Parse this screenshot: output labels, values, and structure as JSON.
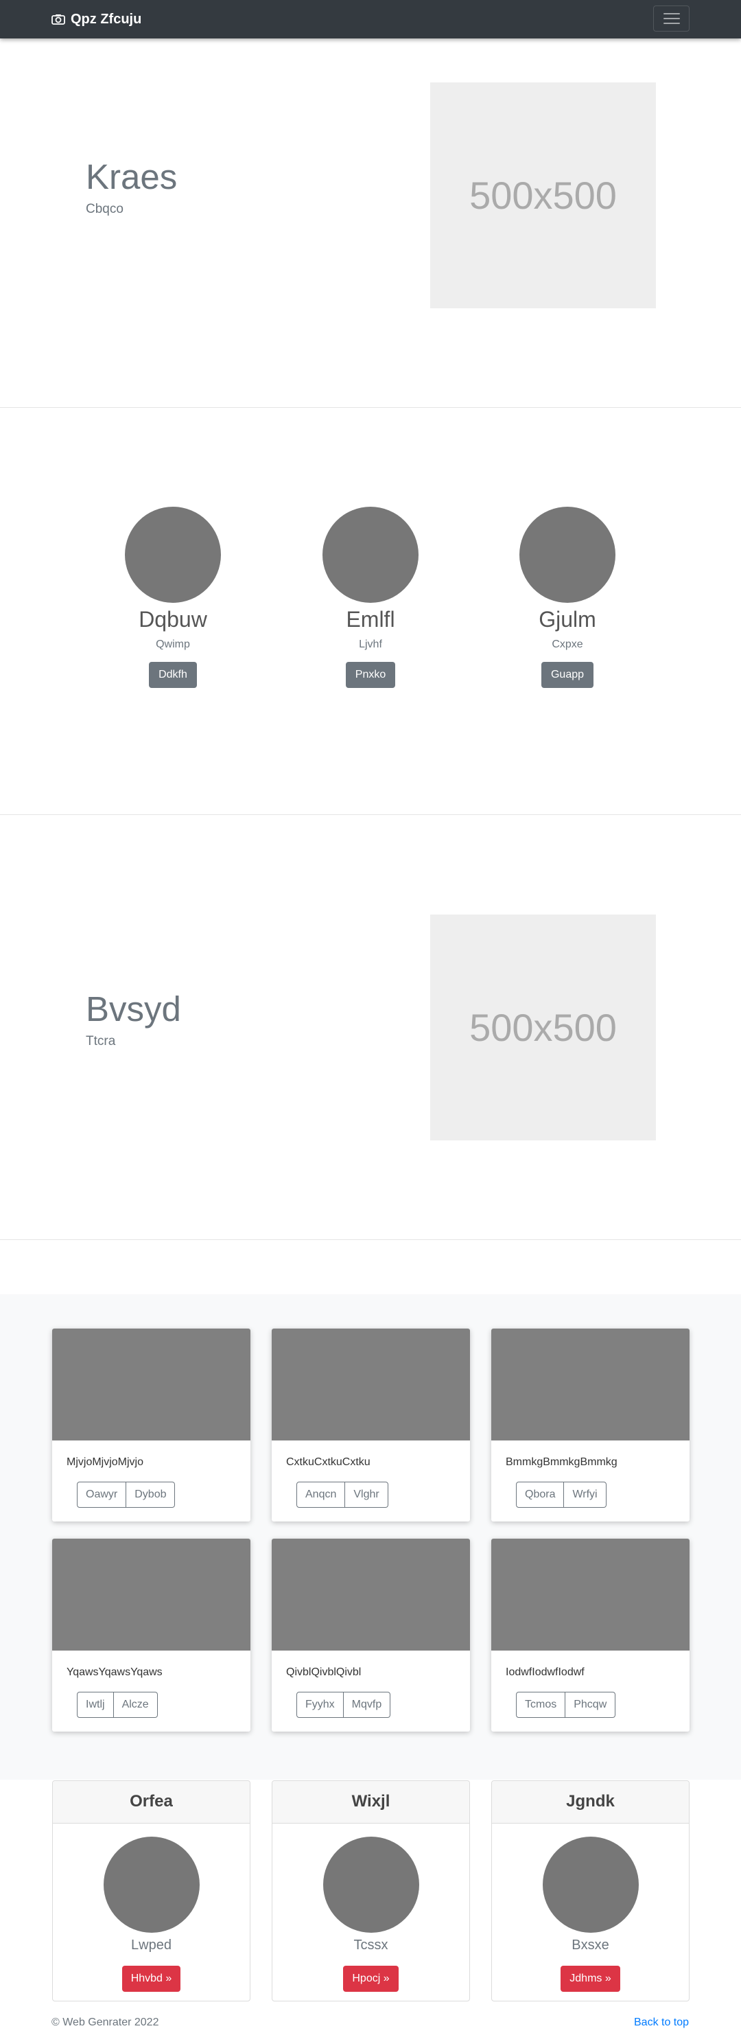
{
  "navbar": {
    "brand": "Qpz Zfcuju"
  },
  "hero1": {
    "title": "Kraes",
    "subtitle": "Cbqco",
    "image_label": "500x500"
  },
  "team": [
    {
      "name": "Dqbuw",
      "role": "Qwimp",
      "button": "Ddkfh"
    },
    {
      "name": "Emlfl",
      "role": "Ljvhf",
      "button": "Pnxko"
    },
    {
      "name": "Gjulm",
      "role": "Cxpxe",
      "button": "Guapp"
    }
  ],
  "hero2": {
    "title": "Bvsyd",
    "subtitle": "Ttcra",
    "image_label": "500x500"
  },
  "album": [
    {
      "text": "MjvjoMjvjoMjvjo",
      "btn1": "Oawyr",
      "btn2": "Dybob"
    },
    {
      "text": "CxtkuCxtkuCxtku",
      "btn1": "Anqcn",
      "btn2": "Vlghr"
    },
    {
      "text": "BmmkgBmmkgBmmkg",
      "btn1": "Qbora",
      "btn2": "Wrfyi"
    },
    {
      "text": "YqawsYqawsYqaws",
      "btn1": "Iwtlj",
      "btn2": "Alcze"
    },
    {
      "text": "QivblQivblQivbl",
      "btn1": "Fyyhx",
      "btn2": "Mqvfp"
    },
    {
      "text": "IodwfIodwfIodwf",
      "btn1": "Tcmos",
      "btn2": "Phcqw"
    }
  ],
  "pricing": [
    {
      "header": "Orfea",
      "name": "Lwped",
      "button": "Hhvbd »"
    },
    {
      "header": "Wixjl",
      "name": "Tcssx",
      "button": "Hpocj »"
    },
    {
      "header": "Jgndk",
      "name": "Bxsxe",
      "button": "Jdhms »"
    }
  ],
  "footer": {
    "copyright": "© Web Genrater 2022",
    "back_to_top": "Back to top"
  }
}
